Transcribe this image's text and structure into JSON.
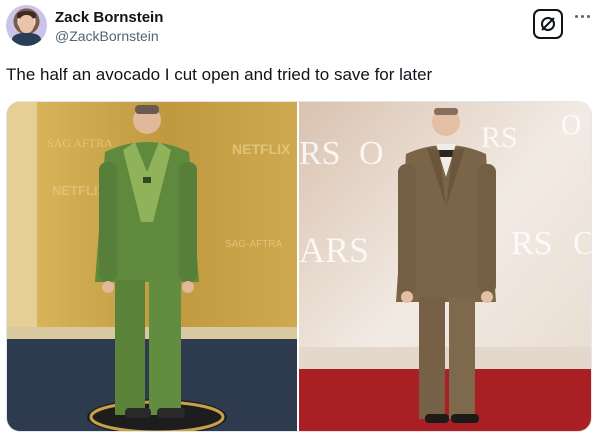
{
  "tweet": {
    "display_name": "Zack Bornstein",
    "handle": "@ZackBornstein",
    "text": "The half an avocado I cut open and tried to save for later",
    "avatar_icon": "profile-avatar",
    "grok_icon": "grok-slash-icon",
    "more_icon": "more-dots-icon"
  },
  "media": {
    "left_photo": {
      "backdrop_text": [
        "SAG AFTRA",
        "NETFLIX",
        "NETFLIX",
        "SAG-AFTRA"
      ],
      "colors": {
        "backdrop": "#c8a24a",
        "suit": "#5f8a3e",
        "carpet": "#2e3a4e"
      }
    },
    "right_photo": {
      "backdrop_text": [
        "RS",
        "O",
        "RS",
        "O",
        "ARS",
        "RS",
        "O"
      ],
      "colors": {
        "backdrop": "#efe6de",
        "suit": "#7a6548",
        "carpet": "#a91f24"
      }
    }
  },
  "colors": {
    "text": "#0f1419",
    "muted": "#536471",
    "border": "#e1e8ed"
  }
}
